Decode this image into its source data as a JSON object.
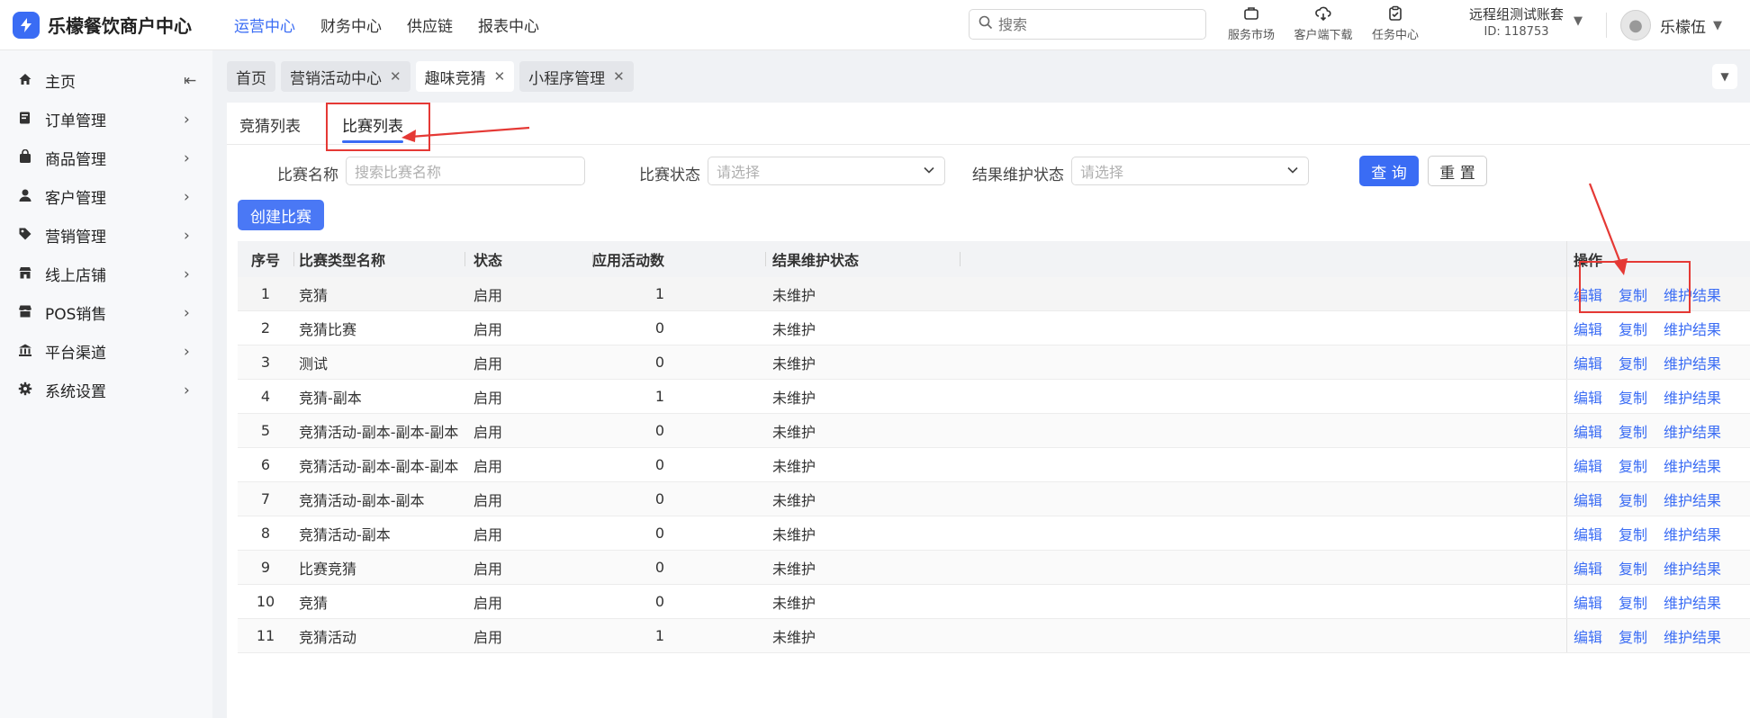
{
  "brand": {
    "name": "乐檬餐饮商户中心",
    "logo_icon": "lightning-icon"
  },
  "top_nav": [
    "运营中心",
    "财务中心",
    "供应链",
    "报表中心"
  ],
  "search": {
    "placeholder": "搜索"
  },
  "tools": [
    {
      "label": "服务市场",
      "icon": "briefcase-icon"
    },
    {
      "label": "客户端下载",
      "icon": "cloud-download-icon"
    },
    {
      "label": "任务中心",
      "icon": "clipboard-icon"
    }
  ],
  "account": {
    "name": "远程组测试账套",
    "id": "ID: 118753"
  },
  "user": {
    "name": "乐檬伍"
  },
  "sidebar": [
    {
      "label": "主页",
      "icon": "home-icon"
    },
    {
      "label": "订单管理",
      "icon": "order-icon"
    },
    {
      "label": "商品管理",
      "icon": "bag-icon"
    },
    {
      "label": "客户管理",
      "icon": "user-icon"
    },
    {
      "label": "营销管理",
      "icon": "tag-icon"
    },
    {
      "label": "线上店铺",
      "icon": "shop-icon"
    },
    {
      "label": "POS销售",
      "icon": "store-icon"
    },
    {
      "label": "平台渠道",
      "icon": "bank-icon"
    },
    {
      "label": "系统设置",
      "icon": "gear-icon"
    }
  ],
  "page_tabs": [
    {
      "label": "首页",
      "closable": false
    },
    {
      "label": "营销活动中心",
      "closable": true
    },
    {
      "label": "趣味竞猜",
      "closable": true
    },
    {
      "label": "小程序管理",
      "closable": true
    }
  ],
  "sub_tabs": [
    "竞猜列表",
    "比赛列表"
  ],
  "filters": {
    "name_label": "比赛名称",
    "name_placeholder": "搜索比赛名称",
    "status_label": "比赛状态",
    "status_placeholder": "请选择",
    "maint_label": "结果维护状态",
    "maint_placeholder": "请选择",
    "query": "查 询",
    "reset": "重 置"
  },
  "create_button": "创建比赛",
  "table": {
    "headers": [
      "序号",
      "比赛类型名称",
      "状态",
      "应用活动数",
      "结果维护状态",
      "操作"
    ],
    "rows": [
      {
        "idx": "1",
        "name": "竞猜",
        "status": "启用",
        "count": "1",
        "maint": "未维护"
      },
      {
        "idx": "2",
        "name": "竞猜比赛",
        "status": "启用",
        "count": "0",
        "maint": "未维护"
      },
      {
        "idx": "3",
        "name": "测试",
        "status": "启用",
        "count": "0",
        "maint": "未维护"
      },
      {
        "idx": "4",
        "name": "竞猜-副本",
        "status": "启用",
        "count": "1",
        "maint": "未维护"
      },
      {
        "idx": "5",
        "name": "竞猜活动-副本-副本-副本",
        "status": "启用",
        "count": "0",
        "maint": "未维护"
      },
      {
        "idx": "6",
        "name": "竞猜活动-副本-副本-副本",
        "status": "启用",
        "count": "0",
        "maint": "未维护"
      },
      {
        "idx": "7",
        "name": "竞猜活动-副本-副本",
        "status": "启用",
        "count": "0",
        "maint": "未维护"
      },
      {
        "idx": "8",
        "name": "竞猜活动-副本",
        "status": "启用",
        "count": "0",
        "maint": "未维护"
      },
      {
        "idx": "9",
        "name": "比赛竞猜",
        "status": "启用",
        "count": "0",
        "maint": "未维护"
      },
      {
        "idx": "10",
        "name": "竞猜",
        "status": "启用",
        "count": "0",
        "maint": "未维护"
      },
      {
        "idx": "11",
        "name": "竞猜活动",
        "status": "启用",
        "count": "1",
        "maint": "未维护"
      }
    ],
    "actions": [
      "编辑",
      "复制",
      "维护结果"
    ]
  },
  "colors": {
    "accent": "#3a6cf4",
    "annotation": "#e53935"
  }
}
